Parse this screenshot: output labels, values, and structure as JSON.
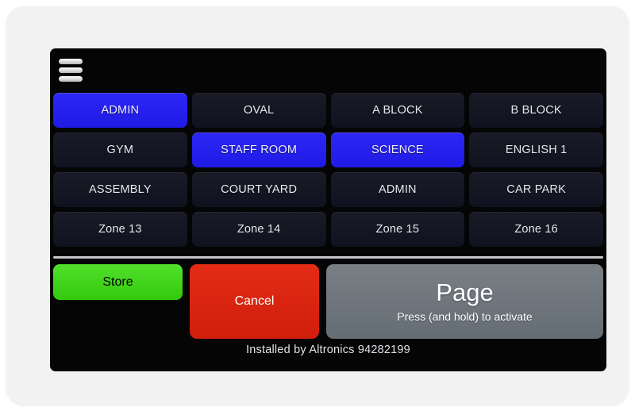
{
  "device": {
    "bezel_color": "#f2f2f3",
    "screen_color": "#050505"
  },
  "header": {
    "menu_icon": "hamburger-menu-icon"
  },
  "colors": {
    "zone_unselected": "#13151f",
    "zone_selected": "#2420ee",
    "store_green": "#3ed417",
    "cancel_red": "#dd2410",
    "page_gray": "#6f777d",
    "divider": "#e6e8ea"
  },
  "zones": [
    {
      "label": "ADMIN",
      "selected": true
    },
    {
      "label": "OVAL",
      "selected": false
    },
    {
      "label": "A BLOCK",
      "selected": false
    },
    {
      "label": "B BLOCK",
      "selected": false
    },
    {
      "label": "GYM",
      "selected": false
    },
    {
      "label": "STAFF ROOM",
      "selected": true
    },
    {
      "label": "SCIENCE",
      "selected": true
    },
    {
      "label": "ENGLISH 1",
      "selected": false
    },
    {
      "label": "ASSEMBLY",
      "selected": false
    },
    {
      "label": "COURT YARD",
      "selected": false
    },
    {
      "label": "ADMIN",
      "selected": false
    },
    {
      "label": "CAR PARK",
      "selected": false
    },
    {
      "label": "Zone 13",
      "selected": false
    },
    {
      "label": "Zone 14",
      "selected": false
    },
    {
      "label": "Zone 15",
      "selected": false
    },
    {
      "label": "Zone 16",
      "selected": false
    }
  ],
  "actions": {
    "store_label": "Store",
    "cancel_label": "Cancel",
    "page_label": "Page",
    "page_hint": "Press (and hold) to activate"
  },
  "footer": {
    "installed_by": "Installed by Altronics 94282199"
  }
}
